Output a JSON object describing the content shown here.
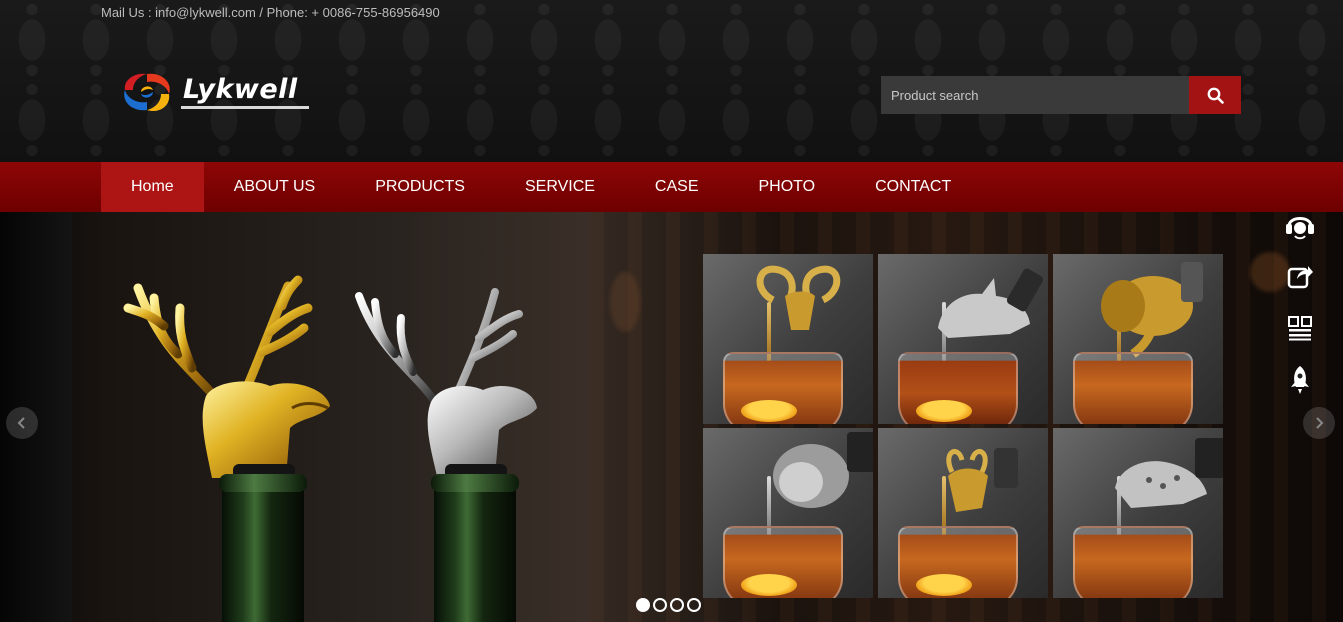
{
  "topbar": {
    "contact": "Mail Us : info@lykwell.com / Phone: + 0086-755-86956490"
  },
  "brand": {
    "name": "Lykwell"
  },
  "search": {
    "placeholder": "Product search",
    "button_icon": "search-icon"
  },
  "nav": {
    "items": [
      {
        "label": "Home",
        "active": true
      },
      {
        "label": "ABOUT US",
        "active": false
      },
      {
        "label": "PRODUCTS",
        "active": false
      },
      {
        "label": "SERVICE",
        "active": false
      },
      {
        "label": "CASE",
        "active": false
      },
      {
        "label": "PHOTO",
        "active": false
      },
      {
        "label": "CONTACT",
        "active": false
      }
    ]
  },
  "sidebar": {
    "icons": [
      "headset-support-icon",
      "share-icon",
      "qr-code-icon",
      "rocket-top-icon"
    ]
  },
  "slider": {
    "total_slides": 4,
    "current_slide": 1,
    "prev_icon": "chevron-left-icon",
    "next_icon": "chevron-right-icon"
  },
  "colors": {
    "nav_bg": "#7e0303",
    "nav_active": "#ad1414",
    "search_button": "#a31313"
  }
}
